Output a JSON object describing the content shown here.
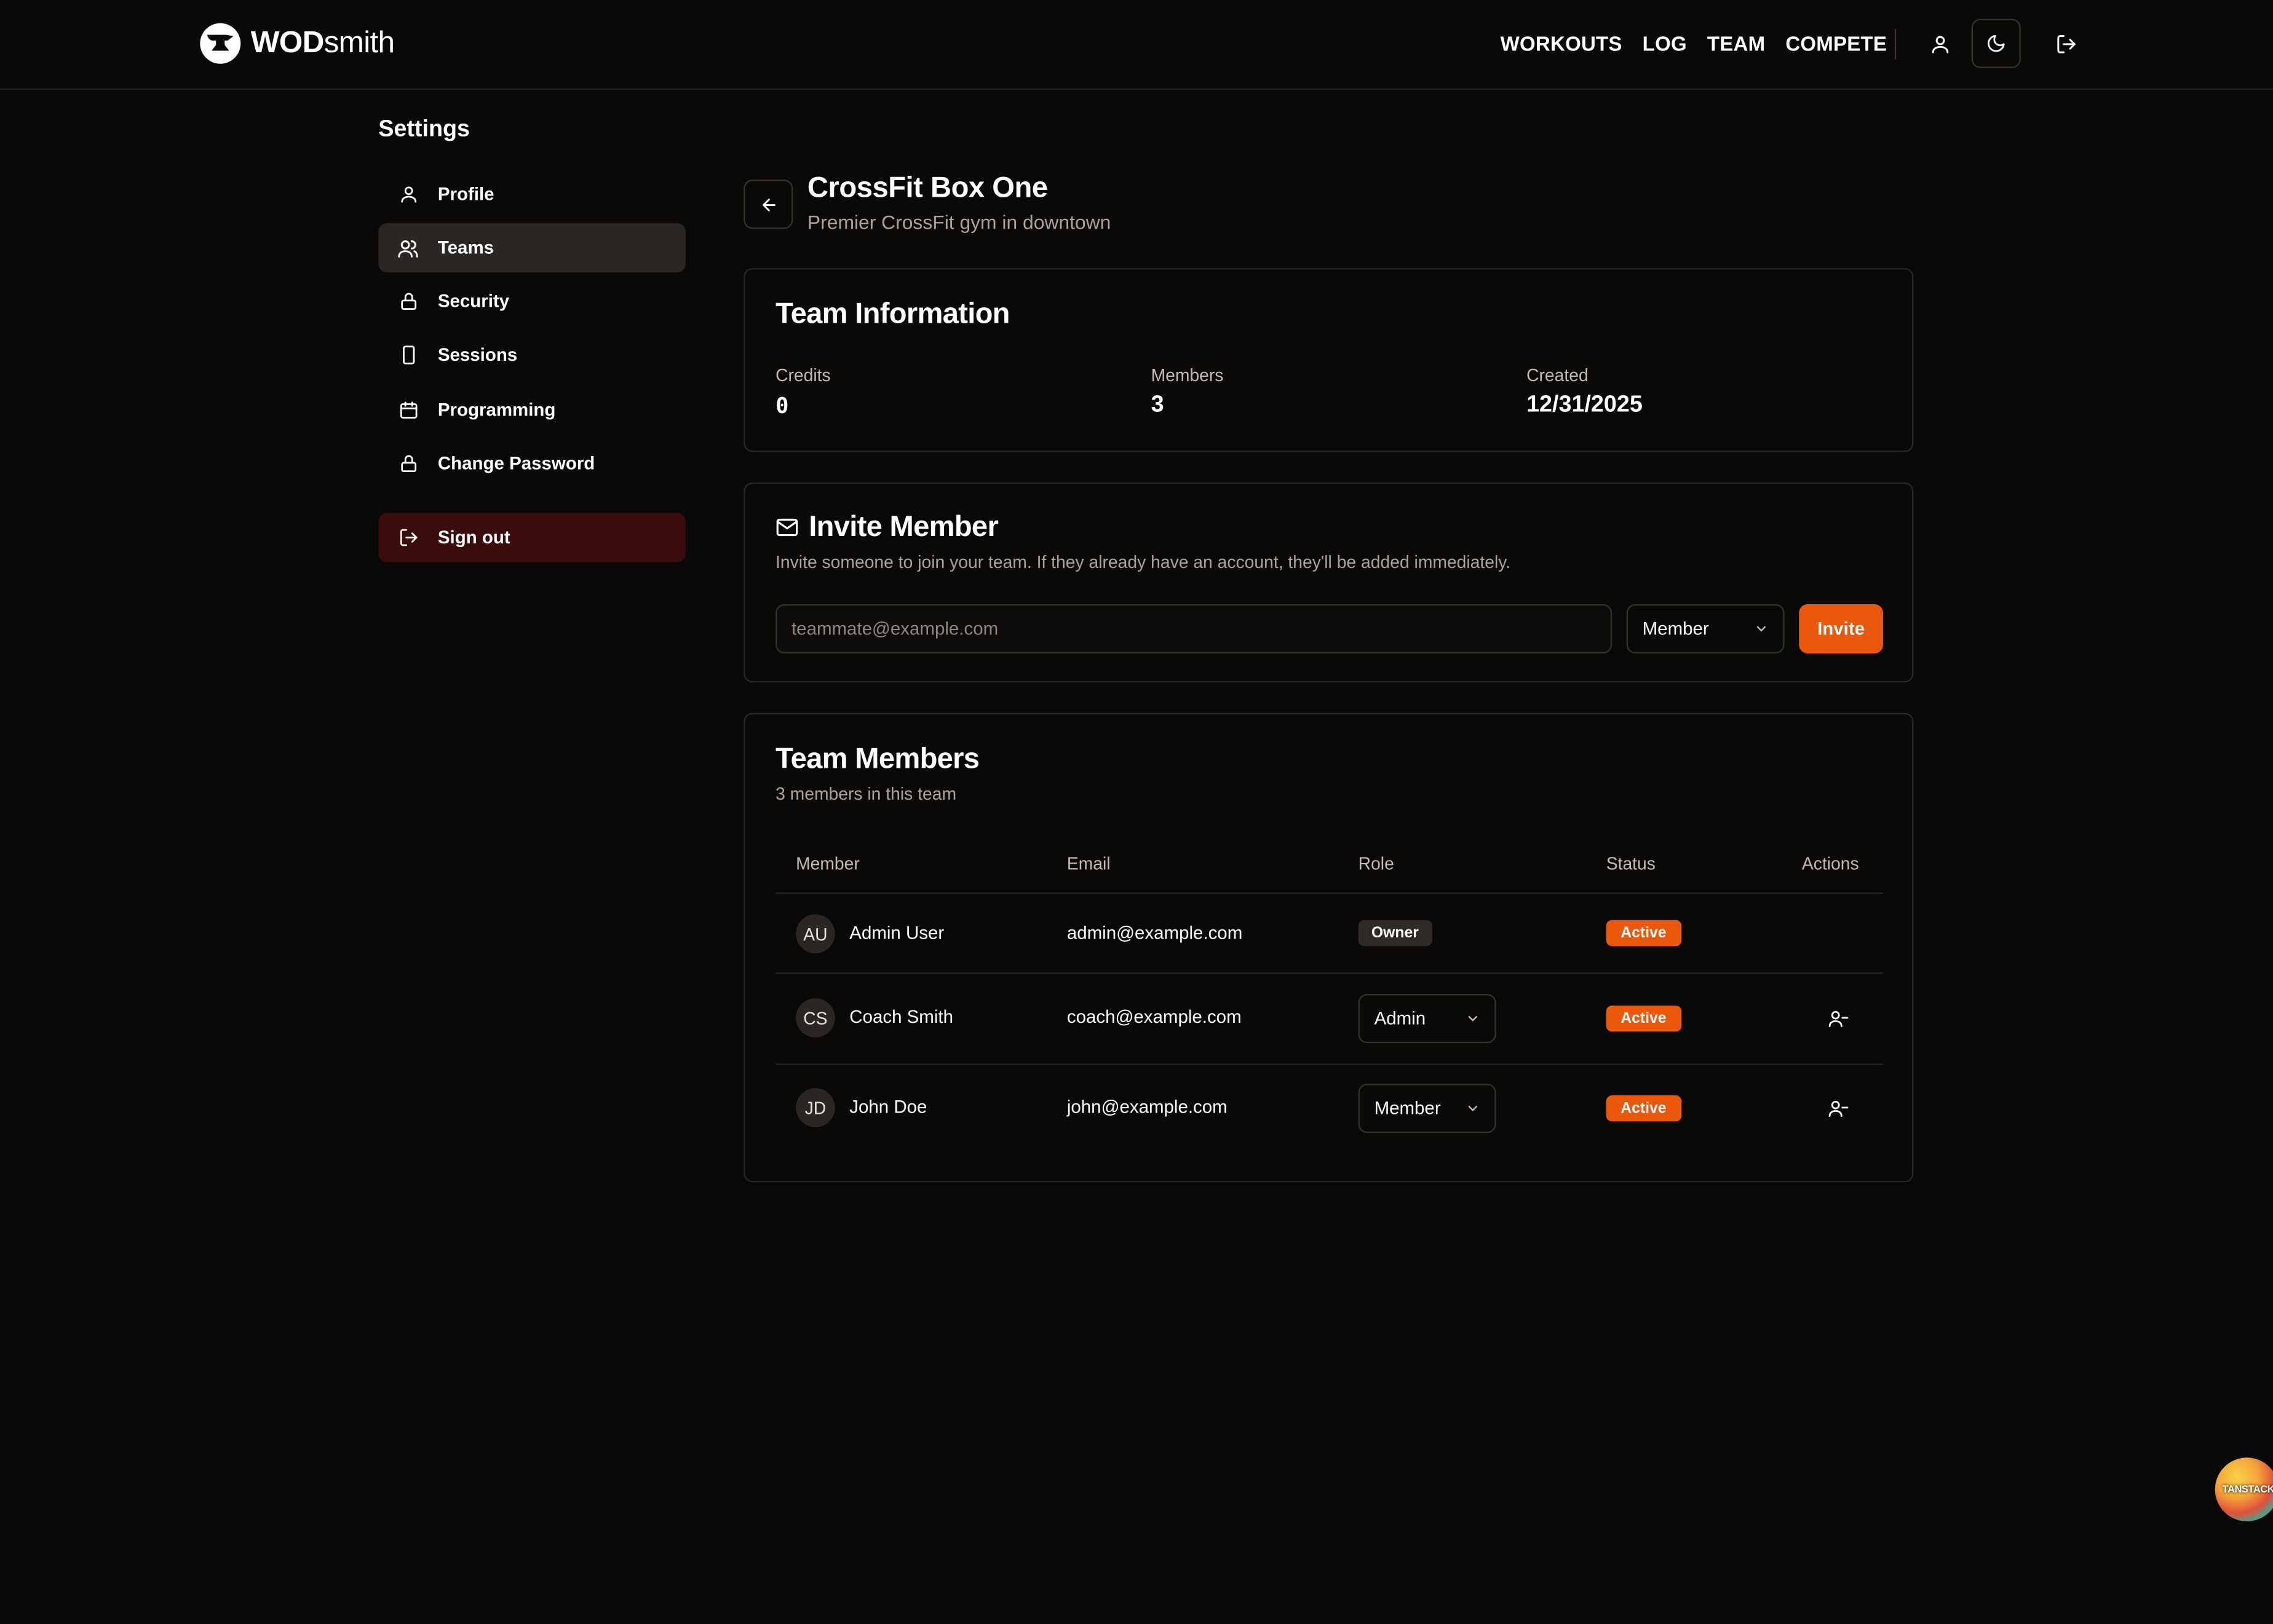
{
  "brand": {
    "bold": "WOD",
    "regular": "smith"
  },
  "nav": [
    "WORKOUTS",
    "LOG",
    "TEAM",
    "COMPETE"
  ],
  "sidebar": {
    "title": "Settings",
    "items": [
      {
        "label": "Profile",
        "icon": "user-icon"
      },
      {
        "label": "Teams",
        "icon": "users-icon",
        "active": true
      },
      {
        "label": "Security",
        "icon": "lock-icon"
      },
      {
        "label": "Sessions",
        "icon": "device-icon"
      },
      {
        "label": "Programming",
        "icon": "calendar-icon"
      },
      {
        "label": "Change Password",
        "icon": "lock-icon"
      }
    ],
    "signout": "Sign out"
  },
  "team": {
    "name": "CrossFit Box One",
    "description": "Premier CrossFit gym in downtown"
  },
  "team_info": {
    "title": "Team Information",
    "credits_label": "Credits",
    "credits": "0",
    "members_label": "Members",
    "members": "3",
    "created_label": "Created",
    "created": "12/31/2025"
  },
  "invite": {
    "title": "Invite Member",
    "description": "Invite someone to join your team. If they already have an account, they'll be added immediately.",
    "placeholder": "teammate@example.com",
    "role": "Member",
    "button": "Invite"
  },
  "members": {
    "title": "Team Members",
    "subtitle": "3 members in this team",
    "columns": [
      "Member",
      "Email",
      "Role",
      "Status",
      "Actions"
    ],
    "rows": [
      {
        "initials": "AU",
        "name": "Admin User",
        "email": "admin@example.com",
        "role": "Owner",
        "status": "Active"
      },
      {
        "initials": "CS",
        "name": "Coach Smith",
        "email": "coach@example.com",
        "role": "Admin",
        "status": "Active"
      },
      {
        "initials": "JD",
        "name": "John Doe",
        "email": "john@example.com",
        "role": "Member",
        "status": "Active"
      }
    ]
  },
  "devtools": {
    "label": "TANSTACK"
  },
  "colors": {
    "accent": "#ea580c",
    "background": "#0a0908",
    "signout_bg": "#3b0c0c"
  }
}
